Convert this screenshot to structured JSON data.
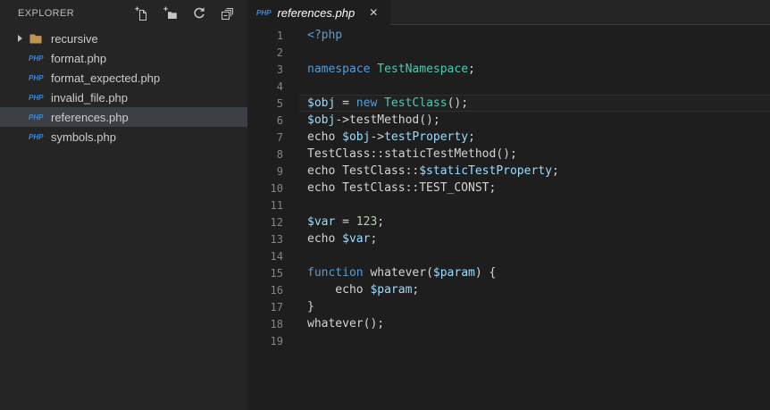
{
  "explorer": {
    "title": "EXPLORER",
    "php_badge": "PHP",
    "actions": [
      {
        "name": "new-file",
        "label": "New File"
      },
      {
        "name": "new-folder",
        "label": "New Folder"
      },
      {
        "name": "refresh",
        "label": "Refresh"
      },
      {
        "name": "collapse-all",
        "label": "Collapse All"
      }
    ],
    "items": [
      {
        "label": "recursive",
        "kind": "folder",
        "expanded": false,
        "selected": false
      },
      {
        "label": "format.php",
        "kind": "php-file",
        "selected": false
      },
      {
        "label": "format_expected.php",
        "kind": "php-file",
        "selected": false
      },
      {
        "label": "invalid_file.php",
        "kind": "php-file",
        "selected": false
      },
      {
        "label": "references.php",
        "kind": "php-file",
        "selected": true
      },
      {
        "label": "symbols.php",
        "kind": "php-file",
        "selected": false
      }
    ]
  },
  "editor": {
    "tabs": [
      {
        "label": "references.php",
        "icon": "php",
        "close_icon": "✕",
        "active": true,
        "preview": true
      }
    ],
    "active_line": 5,
    "lines": [
      {
        "n": 1,
        "tokens": [
          {
            "t": "<?php",
            "c": "kw"
          }
        ]
      },
      {
        "n": 2,
        "tokens": []
      },
      {
        "n": 3,
        "tokens": [
          {
            "t": "namespace",
            "c": "kw"
          },
          {
            "t": " ",
            "c": "fg"
          },
          {
            "t": "TestNamespace",
            "c": "ty"
          },
          {
            "t": ";",
            "c": "fg"
          }
        ]
      },
      {
        "n": 4,
        "tokens": []
      },
      {
        "n": 5,
        "tokens": [
          {
            "t": "$obj",
            "c": "va"
          },
          {
            "t": " = ",
            "c": "fg"
          },
          {
            "t": "new",
            "c": "kw"
          },
          {
            "t": " ",
            "c": "fg"
          },
          {
            "t": "TestClass",
            "c": "ty"
          },
          {
            "t": "();",
            "c": "fg"
          }
        ]
      },
      {
        "n": 6,
        "tokens": [
          {
            "t": "$obj",
            "c": "va"
          },
          {
            "t": "->testMethod();",
            "c": "fg"
          }
        ]
      },
      {
        "n": 7,
        "tokens": [
          {
            "t": "echo ",
            "c": "fg"
          },
          {
            "t": "$obj",
            "c": "va"
          },
          {
            "t": "->",
            "c": "fg"
          },
          {
            "t": "testProperty",
            "c": "va"
          },
          {
            "t": ";",
            "c": "fg"
          }
        ]
      },
      {
        "n": 8,
        "tokens": [
          {
            "t": "TestClass::staticTestMethod();",
            "c": "fg"
          }
        ]
      },
      {
        "n": 9,
        "tokens": [
          {
            "t": "echo TestClass::",
            "c": "fg"
          },
          {
            "t": "$staticTestProperty",
            "c": "va"
          },
          {
            "t": ";",
            "c": "fg"
          }
        ]
      },
      {
        "n": 10,
        "tokens": [
          {
            "t": "echo TestClass::TEST_CONST;",
            "c": "fg"
          }
        ]
      },
      {
        "n": 11,
        "tokens": []
      },
      {
        "n": 12,
        "tokens": [
          {
            "t": "$var",
            "c": "va"
          },
          {
            "t": " = ",
            "c": "fg"
          },
          {
            "t": "123",
            "c": "nu"
          },
          {
            "t": ";",
            "c": "fg"
          }
        ]
      },
      {
        "n": 13,
        "tokens": [
          {
            "t": "echo ",
            "c": "fg"
          },
          {
            "t": "$var",
            "c": "va"
          },
          {
            "t": ";",
            "c": "fg"
          }
        ]
      },
      {
        "n": 14,
        "tokens": []
      },
      {
        "n": 15,
        "tokens": [
          {
            "t": "function",
            "c": "kw"
          },
          {
            "t": " whatever(",
            "c": "fg"
          },
          {
            "t": "$param",
            "c": "va"
          },
          {
            "t": ") {",
            "c": "fg"
          }
        ]
      },
      {
        "n": 16,
        "tokens": [
          {
            "t": "    echo ",
            "c": "fg"
          },
          {
            "t": "$param",
            "c": "va"
          },
          {
            "t": ";",
            "c": "fg"
          }
        ]
      },
      {
        "n": 17,
        "tokens": [
          {
            "t": "}",
            "c": "fg"
          }
        ]
      },
      {
        "n": 18,
        "tokens": [
          {
            "t": "whatever();",
            "c": "fg"
          }
        ]
      },
      {
        "n": 19,
        "tokens": []
      }
    ]
  },
  "colors": {
    "editor_bg": "#1e1e1e",
    "sidebar_bg": "#252526",
    "selection_bg": "#3c4046",
    "keyword": "#569cd6",
    "type": "#4ec9b0",
    "variable": "#9cdcfe",
    "number": "#b5cea8",
    "default_text": "#d4d4d4",
    "line_number": "#858585",
    "php_icon": "#3b89d9",
    "folder_icon": "#c09553"
  }
}
